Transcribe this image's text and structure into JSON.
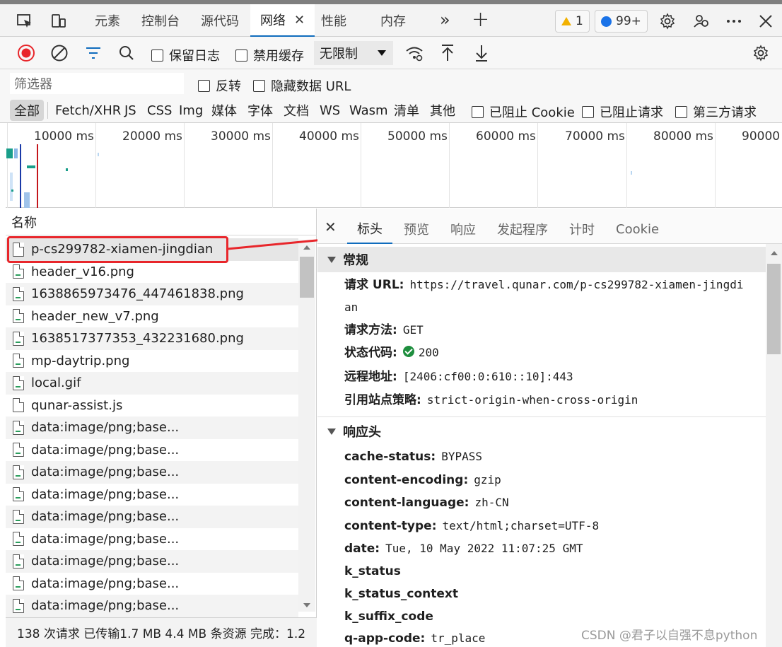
{
  "tabs": {
    "items": [
      "元素",
      "控制台",
      "源代码",
      "网络",
      "性能",
      "内存"
    ],
    "active_close": "✕",
    "more": "»",
    "add": "+",
    "warnings": "1",
    "messages": "99+"
  },
  "toolbar": {
    "preserve_log": "保留日志",
    "disable_cache": "禁用缓存",
    "throttle": "无限制"
  },
  "filter": {
    "placeholder": "筛选器",
    "invert": "反转",
    "hide_data_urls": "隐藏数据 URL"
  },
  "types": {
    "all": "全部",
    "items": [
      "Fetch/XHR",
      "JS",
      "CSS",
      "Img",
      "媒体",
      "字体",
      "文档",
      "WS",
      "Wasm",
      "清单",
      "其他"
    ],
    "blocked_cookies": "已阻止 Cookie",
    "blocked_requests": "已阻止请求",
    "third_party": "第三方请求"
  },
  "timeline": {
    "ticks": [
      "10000 ms",
      "20000 ms",
      "30000 ms",
      "40000 ms",
      "50000 ms",
      "60000 ms",
      "70000 ms",
      "80000 ms",
      "90000"
    ]
  },
  "requests": {
    "header": "名称",
    "items": [
      "p-cs299782-xiamen-jingdian",
      "header_v16.png",
      "1638865973476_447461838.png",
      "header_new_v7.png",
      "1638517377353_432231680.png",
      "mp-daytrip.png",
      "local.gif",
      "qunar-assist.js",
      "data:image/png;base...",
      "data:image/png;base...",
      "data:image/png;base...",
      "data:image/png;base...",
      "data:image/png;base...",
      "data:image/png;base...",
      "data:image/png;base...",
      "data:image/png;base...",
      "data:image/png;base..."
    ]
  },
  "status": {
    "text": "138 次请求  已传输1.7 MB  4.4 MB 条资源  完成：1.2"
  },
  "details": {
    "close": "✕",
    "tabs": [
      "标头",
      "预览",
      "响应",
      "发起程序",
      "计时",
      "Cookie"
    ],
    "general_title": "常规",
    "general": [
      {
        "k": "请求 URL:",
        "v": "https://travel.qunar.com/p-cs299782-xiamen-jingdi"
      },
      {
        "k": "",
        "v": "an"
      },
      {
        "k": "请求方法:",
        "v": "GET"
      },
      {
        "k": "状态代码:",
        "v": "200"
      },
      {
        "k": "远程地址:",
        "v": "[2406:cf00:0:610::10]:443"
      },
      {
        "k": "引用站点策略:",
        "v": "strict-origin-when-cross-origin"
      }
    ],
    "response_title": "响应头",
    "response": [
      {
        "k": "cache-status:",
        "v": "BYPASS"
      },
      {
        "k": "content-encoding:",
        "v": "gzip"
      },
      {
        "k": "content-language:",
        "v": "zh-CN"
      },
      {
        "k": "content-type:",
        "v": "text/html;charset=UTF-8"
      },
      {
        "k": "date:",
        "v": "Tue, 10 May 2022 11:07:25 GMT"
      },
      {
        "k": "k_status",
        "v": ""
      },
      {
        "k": "k_status_context",
        "v": ""
      },
      {
        "k": "k_suffix_code",
        "v": ""
      },
      {
        "k": "q-app-code:",
        "v": "tr_place"
      }
    ]
  },
  "watermark": "CSDN @君子以自强不息python",
  "colors": {
    "accent": "#0f6cbd",
    "record": "#e8262b",
    "highlight_box": "#e8262b",
    "ok": "#1e8e3e"
  }
}
